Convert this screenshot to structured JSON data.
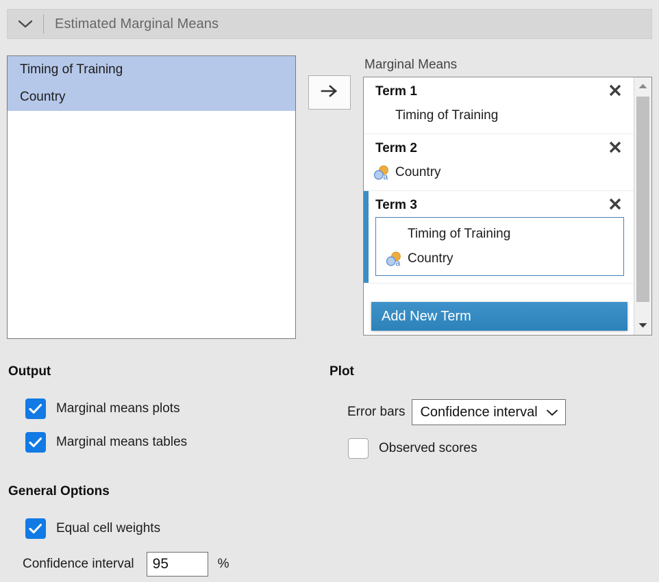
{
  "header": {
    "title": "Estimated Marginal Means",
    "collapse_icon": "chevron-down-icon"
  },
  "variable_list": {
    "items": [
      {
        "label": "Timing of Training",
        "selected": true
      },
      {
        "label": "Country",
        "selected": true
      }
    ]
  },
  "transfer": {
    "arrow_icon": "arrow-right-icon"
  },
  "marginal_means": {
    "label": "Marginal Means",
    "add_new_term_label": "Add New Term",
    "close_icon": "close-icon",
    "terms": [
      {
        "title": "Term 1",
        "active": false,
        "boxed": false,
        "variables": [
          {
            "label": "Timing of Training",
            "icon": "none"
          }
        ]
      },
      {
        "title": "Term 2",
        "active": false,
        "boxed": false,
        "variables": [
          {
            "label": "Country",
            "icon": "nominal-text-icon"
          }
        ]
      },
      {
        "title": "Term 3",
        "active": true,
        "boxed": true,
        "variables": [
          {
            "label": "Timing of Training",
            "icon": "none"
          },
          {
            "label": "Country",
            "icon": "nominal-text-icon"
          }
        ]
      }
    ],
    "scrollbar": {
      "up_icon": "caret-up-icon",
      "down_icon": "caret-down-icon"
    }
  },
  "output": {
    "title": "Output",
    "options": [
      {
        "label": "Marginal means plots",
        "checked": true
      },
      {
        "label": "Marginal means tables",
        "checked": true
      }
    ]
  },
  "plot": {
    "title": "Plot",
    "error_bars_label": "Error bars",
    "error_bars_value": "Confidence interval",
    "error_bars_options": [
      "Confidence interval"
    ],
    "observed_scores_label": "Observed scores",
    "observed_scores_checked": false,
    "chevron_icon": "chevron-down-icon"
  },
  "general_options": {
    "title": "General Options",
    "equal_cell_weights_label": "Equal cell weights",
    "equal_cell_weights_checked": true,
    "confidence_interval_label": "Confidence interval",
    "confidence_interval_value": "95",
    "confidence_interval_placeholder": "95",
    "percent_symbol": "%"
  },
  "colors": {
    "accent_blue": "#2d82ba",
    "checkbox_blue": "#117ae4",
    "selection_blue": "#b6c8ea",
    "background": "#e7e7e7",
    "header_bg": "#d7d7d7"
  }
}
